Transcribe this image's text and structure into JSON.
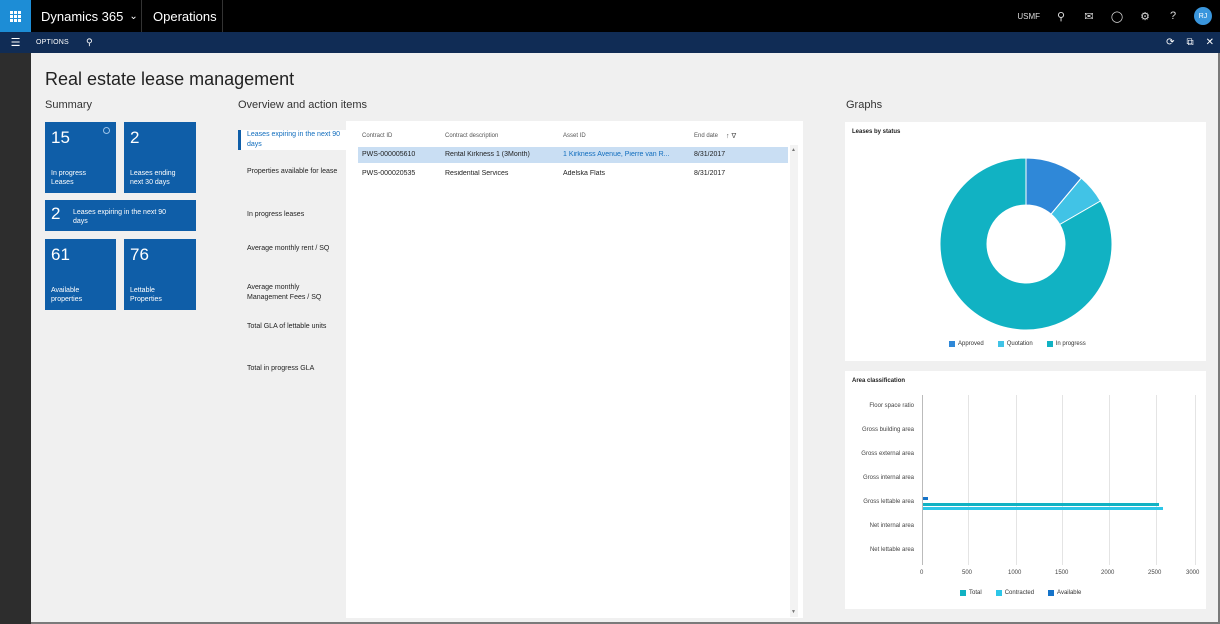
{
  "app": {
    "brand": "Dynamics 365",
    "module": "Operations",
    "company": "USMF",
    "user_initials": "RJ",
    "options_label": "OPTIONS"
  },
  "icons": {
    "waffle": "app-launcher-icon",
    "brand_chevron": "chevron-down-icon",
    "search": "search-icon",
    "message": "message-icon",
    "status": "status-icon",
    "settings": "gear-icon",
    "help": "help-icon",
    "hamburger": "menu-icon",
    "refresh": "refresh-icon",
    "popout": "open-new-window-icon",
    "close": "close-icon"
  },
  "page": {
    "title": "Real estate lease management",
    "summary_heading": "Summary",
    "overview_heading": "Overview and action items",
    "graphs_heading": "Graphs"
  },
  "tiles": [
    {
      "value": "15",
      "label": "In progress\nLeases"
    },
    {
      "value": "2",
      "label": "Leases ending\nnext 30 days"
    },
    {
      "value": "2",
      "label": "Leases expiring in the next 90\ndays"
    },
    {
      "value": "61",
      "label": "Available\nproperties"
    },
    {
      "value": "76",
      "label": "Lettable\nProperties"
    }
  ],
  "overview_tabs": [
    "Leases expiring in the next 90 days",
    "Properties available for lease",
    "In progress leases",
    "Average monthly rent / SQ",
    "Average monthly Management Fees / SQ",
    "Total GLA of lettable units",
    "Total in progress GLA"
  ],
  "grid": {
    "columns": [
      "Contract ID",
      "Contract description",
      "Asset ID",
      "End date"
    ],
    "sort_indicator": "↑ ∇",
    "rows": [
      [
        "PWS-000005610",
        "Rental Kirkness 1 (3Month)",
        "1 Kirkness Avenue, Pierre van R...",
        "8/31/2017"
      ],
      [
        "PWS-000020535",
        "Residential Services",
        "Adelska Flats",
        "8/31/2017"
      ]
    ]
  },
  "colors": {
    "tile": "#0f5ea8",
    "approved": "#2f88d8",
    "quotation": "#41c3e6",
    "in_progress": "#11b2c3",
    "total": "#11b2c3",
    "contracted": "#2dc6e8",
    "available": "#1573c9"
  },
  "chart_data": [
    {
      "type": "pie",
      "title": "Leases by status",
      "donut": true,
      "categories": [
        "Approved",
        "Quotation",
        "In progress"
      ],
      "values": [
        2,
        1,
        15
      ],
      "legend": "bottom"
    },
    {
      "type": "bar",
      "orientation": "horizontal",
      "title": "Area classification",
      "categories": [
        "Floor space ratio",
        "Gross building area",
        "Gross external area",
        "Gross internal area",
        "Gross lettable area",
        "Net internal area",
        "Net lettable area"
      ],
      "series": [
        {
          "name": "Total",
          "values": [
            0,
            0,
            0,
            0,
            2600,
            0,
            0
          ]
        },
        {
          "name": "Contracted",
          "values": [
            0,
            0,
            0,
            0,
            2650,
            0,
            0
          ]
        },
        {
          "name": "Available",
          "values": [
            0,
            0,
            0,
            0,
            50,
            0,
            0
          ]
        }
      ],
      "xticks": [
        "0",
        "500",
        "1000",
        "1500",
        "2000",
        "2500",
        "3000"
      ],
      "xlim": [
        0,
        3000
      ],
      "grid": true,
      "legend": "bottom"
    }
  ]
}
